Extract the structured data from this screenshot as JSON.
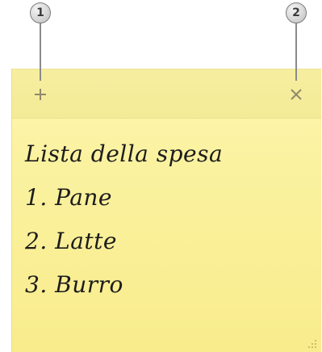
{
  "callouts": [
    {
      "number": "1",
      "target": "new-note-button"
    },
    {
      "number": "2",
      "target": "delete-note-button"
    }
  ],
  "note": {
    "lines": [
      "Lista della spesa",
      "1. Pane",
      "2. Latte",
      "3. Burro"
    ],
    "new_button_icon": "plus-icon",
    "delete_button_icon": "close-icon",
    "background_color": "#fbf2a1"
  }
}
